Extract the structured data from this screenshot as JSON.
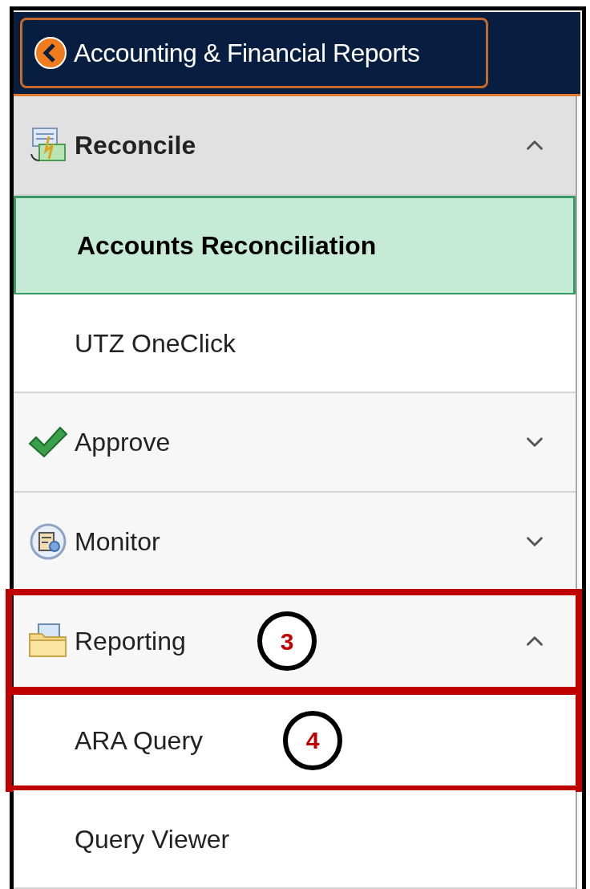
{
  "header": {
    "back_button": "Accounting & Financial Reports"
  },
  "groups": [
    {
      "label": "Reconcile",
      "expanded": true,
      "highlighted": false,
      "items": [
        {
          "label": "Accounts Reconciliation",
          "selected": true,
          "highlighted": false
        },
        {
          "label": "UTZ OneClick",
          "selected": false,
          "highlighted": false
        }
      ]
    },
    {
      "label": "Approve",
      "expanded": false,
      "highlighted": false
    },
    {
      "label": "Monitor",
      "expanded": false,
      "highlighted": false
    },
    {
      "label": "Reporting",
      "expanded": true,
      "highlighted": true,
      "callout": "3",
      "items": [
        {
          "label": "ARA Query",
          "selected": false,
          "highlighted": true,
          "callout": "4"
        },
        {
          "label": "Query Viewer",
          "selected": false,
          "highlighted": false
        }
      ]
    }
  ]
}
